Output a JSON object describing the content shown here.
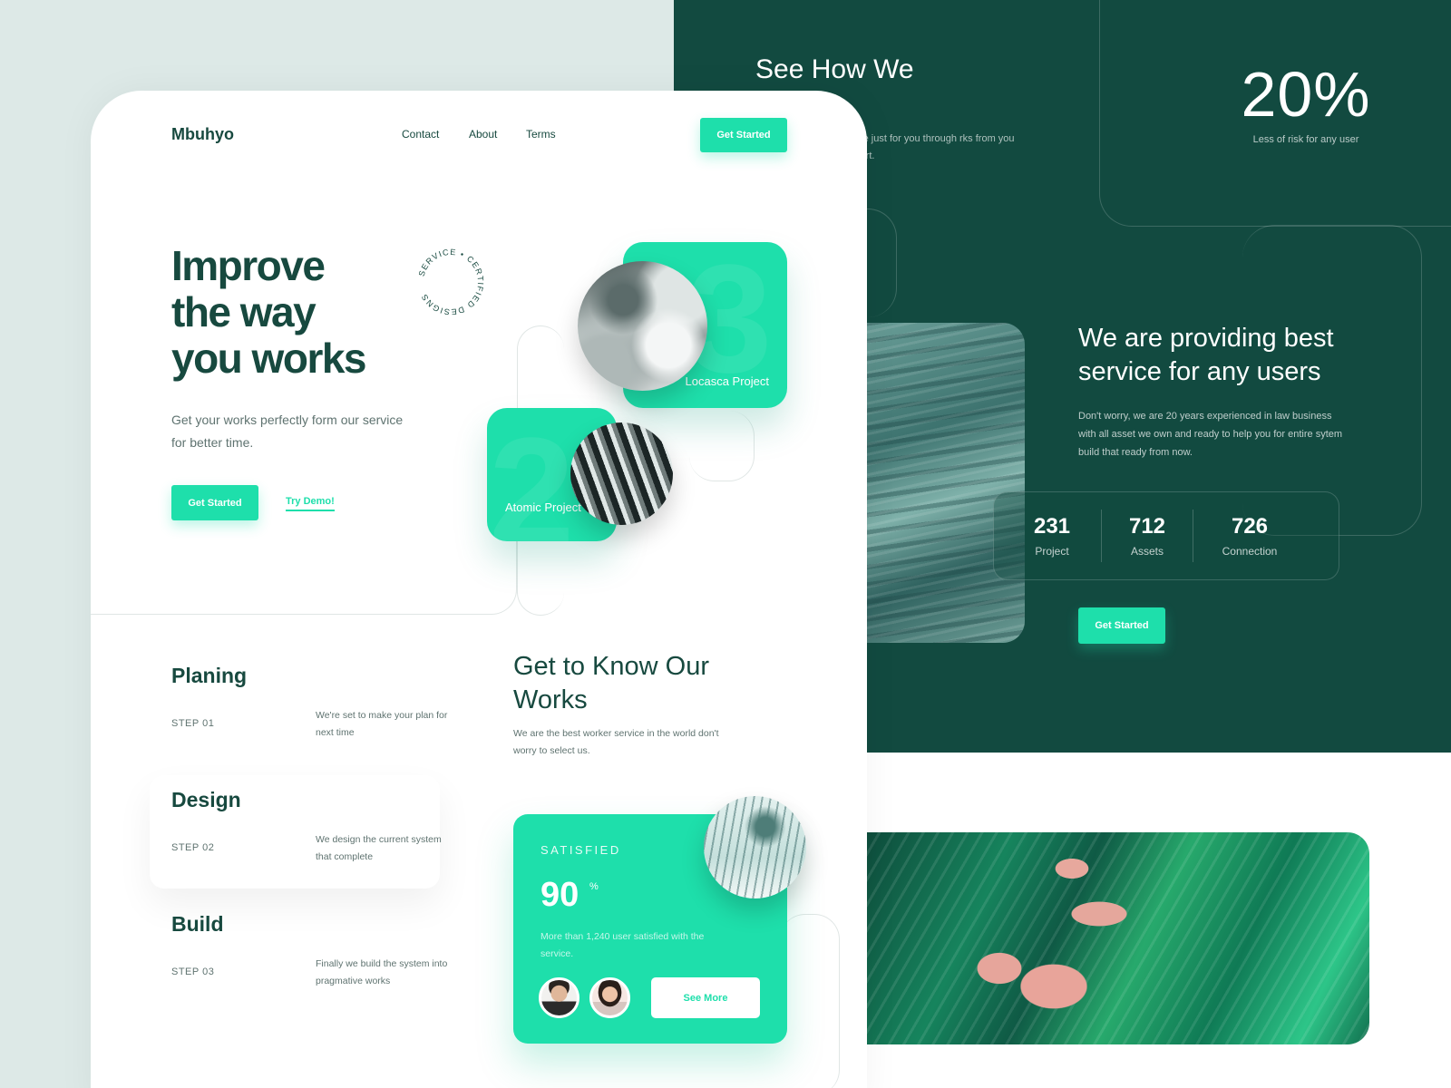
{
  "brand": "Mbuhyo",
  "nav": {
    "links": [
      "Contact",
      "About",
      "Terms"
    ],
    "cta": "Get Started"
  },
  "hero": {
    "title_lines": [
      "Improve",
      "the way",
      "you works"
    ],
    "subtitle": "Get your works perfectly form our service for better time.",
    "cta": "Get Started",
    "demo": "Try Demo!",
    "seal_text": "SERVICE • CERTIFIED DESIGNS"
  },
  "projects": [
    {
      "number": "3",
      "name": "Locasca Project"
    },
    {
      "number": "2",
      "name": "Atomic Project"
    }
  ],
  "steps": [
    {
      "title": "Planing",
      "step": "STEP 01",
      "desc": "We're set to make your plan for next time"
    },
    {
      "title": "Design",
      "step": "STEP 02",
      "desc": "We design the current system that complete"
    },
    {
      "title": "Build",
      "step": "STEP 03",
      "desc": "Finally we build the system into pragmative works"
    }
  ],
  "know": {
    "title": "Get to Know Our Works",
    "text": "We are the best worker service in the world don't worry to select us."
  },
  "satisfied": {
    "label": "SATISFIED",
    "value": "90",
    "unit": "%",
    "text": "More than 1,240 user satisfied with the service.",
    "cta": "See More"
  },
  "dark": {
    "see_how_title": "See How We",
    "see_how_text": "nce just for you through rks from you start.",
    "risk_value": "20%",
    "risk_caption": "Less of risk for any user",
    "serve_title": "We are providing best service for any users",
    "serve_text": "Don't worry, we are 20 years experienced in law business with all asset we own and ready to help you for entire sytem build that ready from now.",
    "stats": [
      {
        "value": "231",
        "label": "Project"
      },
      {
        "value": "712",
        "label": "Assets"
      },
      {
        "value": "726",
        "label": "Connection"
      }
    ],
    "cta": "Get Started"
  },
  "colors": {
    "accent": "#1edfab",
    "dark": "#124a40",
    "text": "#17493f",
    "background": "#dde9e7"
  }
}
